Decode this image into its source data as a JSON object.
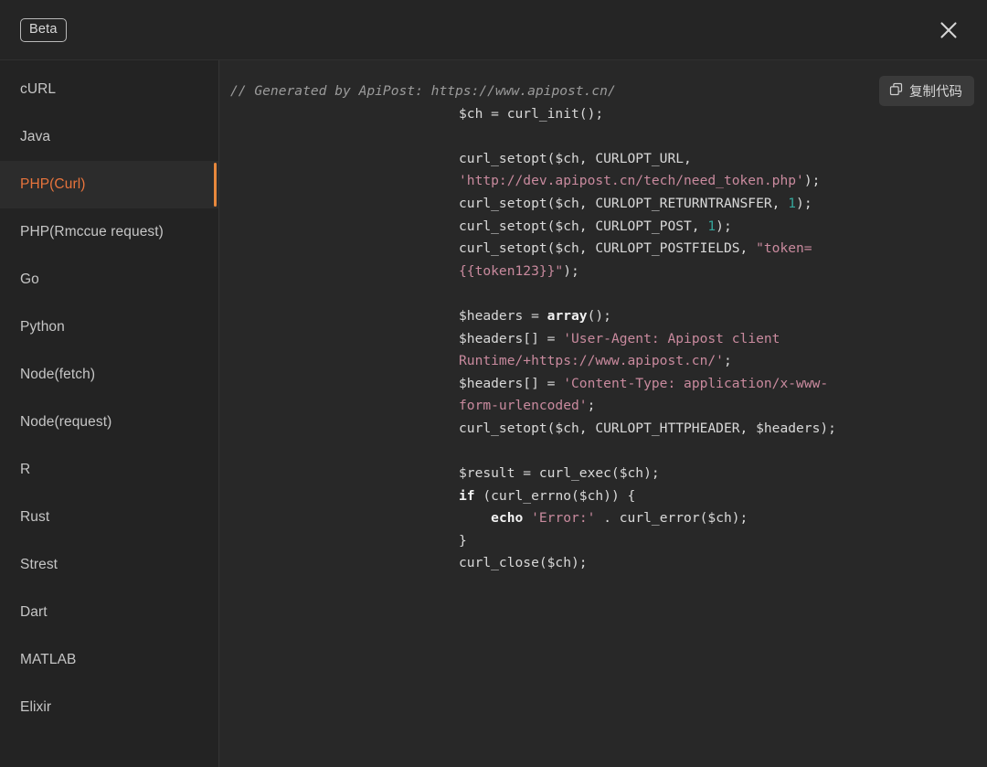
{
  "window": {
    "beta_label": "Beta",
    "close_icon": "close-icon"
  },
  "sidebar": {
    "items": [
      {
        "label": "cURL",
        "active": false
      },
      {
        "label": "Java",
        "active": false
      },
      {
        "label": "PHP(Curl)",
        "active": true
      },
      {
        "label": "PHP(Rmccue request)",
        "active": false
      },
      {
        "label": "Go",
        "active": false
      },
      {
        "label": "Python",
        "active": false
      },
      {
        "label": "Node(fetch)",
        "active": false
      },
      {
        "label": "Node(request)",
        "active": false
      },
      {
        "label": "R",
        "active": false
      },
      {
        "label": "Rust",
        "active": false
      },
      {
        "label": "Strest",
        "active": false
      },
      {
        "label": "Dart",
        "active": false
      },
      {
        "label": "MATLAB",
        "active": false
      },
      {
        "label": "Elixir",
        "active": false
      }
    ]
  },
  "code_panel": {
    "copy_button_label": "复制代码",
    "copy_icon": "copy-icon",
    "language": "PHP(Curl)",
    "lines": [
      [
        {
          "t": "comment",
          "s": "// Generated by ApiPost: https://www.apipost.cn/"
        }
      ],
      [
        {
          "t": "plain",
          "s": "$ch = curl_init();"
        }
      ],
      [
        {
          "t": "plain",
          "s": ""
        }
      ],
      [
        {
          "t": "plain",
          "s": "curl_setopt($ch, CURLOPT_URL, "
        },
        {
          "t": "string",
          "s": "'http://dev.apipost.cn/tech/need_token.php'"
        },
        {
          "t": "plain",
          "s": ");"
        }
      ],
      [
        {
          "t": "plain",
          "s": "curl_setopt($ch, CURLOPT_RETURNTRANSFER, "
        },
        {
          "t": "number",
          "s": "1"
        },
        {
          "t": "plain",
          "s": ");"
        }
      ],
      [
        {
          "t": "plain",
          "s": "curl_setopt($ch, CURLOPT_POST, "
        },
        {
          "t": "number",
          "s": "1"
        },
        {
          "t": "plain",
          "s": ");"
        }
      ],
      [
        {
          "t": "plain",
          "s": "curl_setopt($ch, CURLOPT_POSTFIELDS, "
        },
        {
          "t": "string",
          "s": "\"token={{token123}}\""
        },
        {
          "t": "plain",
          "s": ");"
        }
      ],
      [
        {
          "t": "plain",
          "s": ""
        }
      ],
      [
        {
          "t": "plain",
          "s": "$headers = "
        },
        {
          "t": "keyword",
          "s": "array"
        },
        {
          "t": "plain",
          "s": "();"
        }
      ],
      [
        {
          "t": "plain",
          "s": "$headers[] = "
        },
        {
          "t": "string",
          "s": "'User-Agent: Apipost client Runtime/+https://www.apipost.cn/'"
        },
        {
          "t": "plain",
          "s": ";"
        }
      ],
      [
        {
          "t": "plain",
          "s": "$headers[] = "
        },
        {
          "t": "string",
          "s": "'Content-Type: application/x-www-form-urlencoded'"
        },
        {
          "t": "plain",
          "s": ";"
        }
      ],
      [
        {
          "t": "plain",
          "s": "curl_setopt($ch, CURLOPT_HTTPHEADER, $headers);"
        }
      ],
      [
        {
          "t": "plain",
          "s": ""
        }
      ],
      [
        {
          "t": "plain",
          "s": "$result = curl_exec($ch);"
        }
      ],
      [
        {
          "t": "keyword",
          "s": "if"
        },
        {
          "t": "plain",
          "s": " (curl_errno($ch)) {"
        }
      ],
      [
        {
          "t": "plain",
          "s": "    "
        },
        {
          "t": "keyword",
          "s": "echo"
        },
        {
          "t": "plain",
          "s": " "
        },
        {
          "t": "string",
          "s": "'Error:'"
        },
        {
          "t": "plain",
          "s": " . curl_error($ch);"
        }
      ],
      [
        {
          "t": "plain",
          "s": "}"
        }
      ],
      [
        {
          "t": "plain",
          "s": "curl_close($ch);"
        }
      ]
    ]
  },
  "colors": {
    "window_bg": "#232323",
    "topbar_bg": "#252525",
    "code_bg": "#282828",
    "accent": "#e8883c",
    "active_text": "#e8743c",
    "sidebar_text": "#c6c6c6",
    "code_text": "#d9d9d9",
    "comment": "#9b9b9b",
    "string": "#c98a9e",
    "number": "#35a79c"
  }
}
